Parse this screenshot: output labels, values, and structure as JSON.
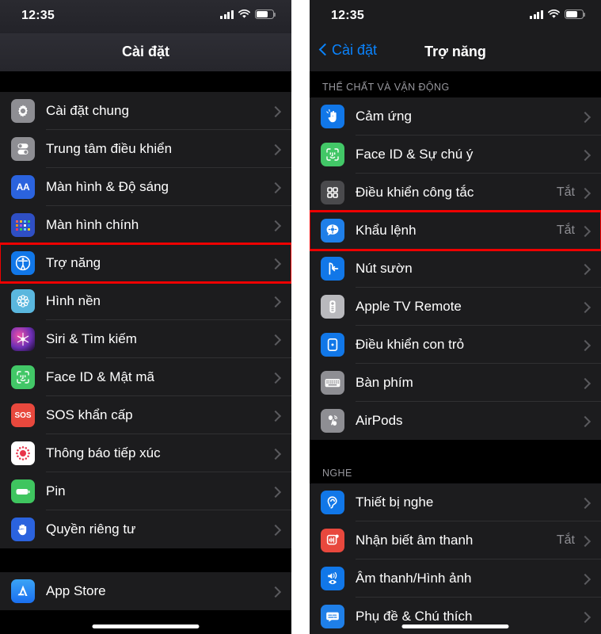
{
  "status_bar": {
    "time": "12:35",
    "icons": [
      "cellular-signal-icon",
      "wifi-icon",
      "battery-icon"
    ]
  },
  "colors": {
    "highlight": "#ee0000",
    "accent_blue": "#0a84ff",
    "list_bg": "#1c1c1e",
    "page_bg": "#000000"
  },
  "left_panel": {
    "nav": {
      "title": "Cài đặt"
    },
    "groups": [
      {
        "items": [
          {
            "label": "Cài đặt chung",
            "icon": "gear-icon",
            "value": "",
            "highlighted": false
          },
          {
            "label": "Trung tâm điều khiển",
            "icon": "control-center-icon",
            "value": "",
            "highlighted": false
          },
          {
            "label": "Màn hình & Độ sáng",
            "icon": "display-brightness-icon",
            "value": "",
            "highlighted": false
          },
          {
            "label": "Màn hình chính",
            "icon": "home-screen-icon",
            "value": "",
            "highlighted": false
          },
          {
            "label": "Trợ năng",
            "icon": "accessibility-icon",
            "value": "",
            "highlighted": true
          },
          {
            "label": "Hình nền",
            "icon": "wallpaper-icon",
            "value": "",
            "highlighted": false
          },
          {
            "label": "Siri & Tìm kiếm",
            "icon": "siri-icon",
            "value": "",
            "highlighted": false
          },
          {
            "label": "Face ID & Mật mã",
            "icon": "face-id-icon",
            "value": "",
            "highlighted": false
          },
          {
            "label": "SOS khẩn cấp",
            "icon": "sos-icon",
            "value": "",
            "highlighted": false
          },
          {
            "label": "Thông báo tiếp xúc",
            "icon": "exposure-notification-icon",
            "value": "",
            "highlighted": false
          },
          {
            "label": "Pin",
            "icon": "battery-icon",
            "value": "",
            "highlighted": false
          },
          {
            "label": "Quyền riêng tư",
            "icon": "privacy-hand-icon",
            "value": "",
            "highlighted": false
          }
        ]
      },
      {
        "items": [
          {
            "label": "App Store",
            "icon": "app-store-icon",
            "value": "",
            "highlighted": false
          }
        ]
      }
    ]
  },
  "right_panel": {
    "nav": {
      "back_label": "Cài đặt",
      "title": "Trợ năng",
      "back_icon": "chevron-left-icon"
    },
    "sections": [
      {
        "header": "THỂ CHẤT VÀ VẬN ĐỘNG",
        "items": [
          {
            "label": "Cảm ứng",
            "icon": "touch-icon",
            "value": "",
            "highlighted": false
          },
          {
            "label": "Face ID & Sự chú ý",
            "icon": "face-id-icon",
            "value": "",
            "highlighted": false
          },
          {
            "label": "Điều khiển công tắc",
            "icon": "switch-control-icon",
            "value": "Tắt",
            "highlighted": false
          },
          {
            "label": "Khẩu lệnh",
            "icon": "voice-control-icon",
            "value": "Tắt",
            "highlighted": true
          },
          {
            "label": "Nút sườn",
            "icon": "side-button-icon",
            "value": "",
            "highlighted": false
          },
          {
            "label": "Apple TV Remote",
            "icon": "tv-remote-icon",
            "value": "",
            "highlighted": false
          },
          {
            "label": "Điều khiển con trỏ",
            "icon": "pointer-control-icon",
            "value": "",
            "highlighted": false
          },
          {
            "label": "Bàn phím",
            "icon": "keyboard-icon",
            "value": "",
            "highlighted": false
          },
          {
            "label": "AirPods",
            "icon": "airpods-icon",
            "value": "",
            "highlighted": false
          }
        ]
      },
      {
        "header": "NGHE",
        "items": [
          {
            "label": "Thiết bị nghe",
            "icon": "hearing-devices-icon",
            "value": "",
            "highlighted": false
          },
          {
            "label": "Nhận biết âm thanh",
            "icon": "sound-recognition-icon",
            "value": "Tắt",
            "highlighted": false
          },
          {
            "label": "Âm thanh/Hình ảnh",
            "icon": "audio-visual-icon",
            "value": "",
            "highlighted": false
          },
          {
            "label": "Phụ đề & Chú thích",
            "icon": "subtitles-captioning-icon",
            "value": "",
            "highlighted": false
          }
        ]
      }
    ]
  }
}
